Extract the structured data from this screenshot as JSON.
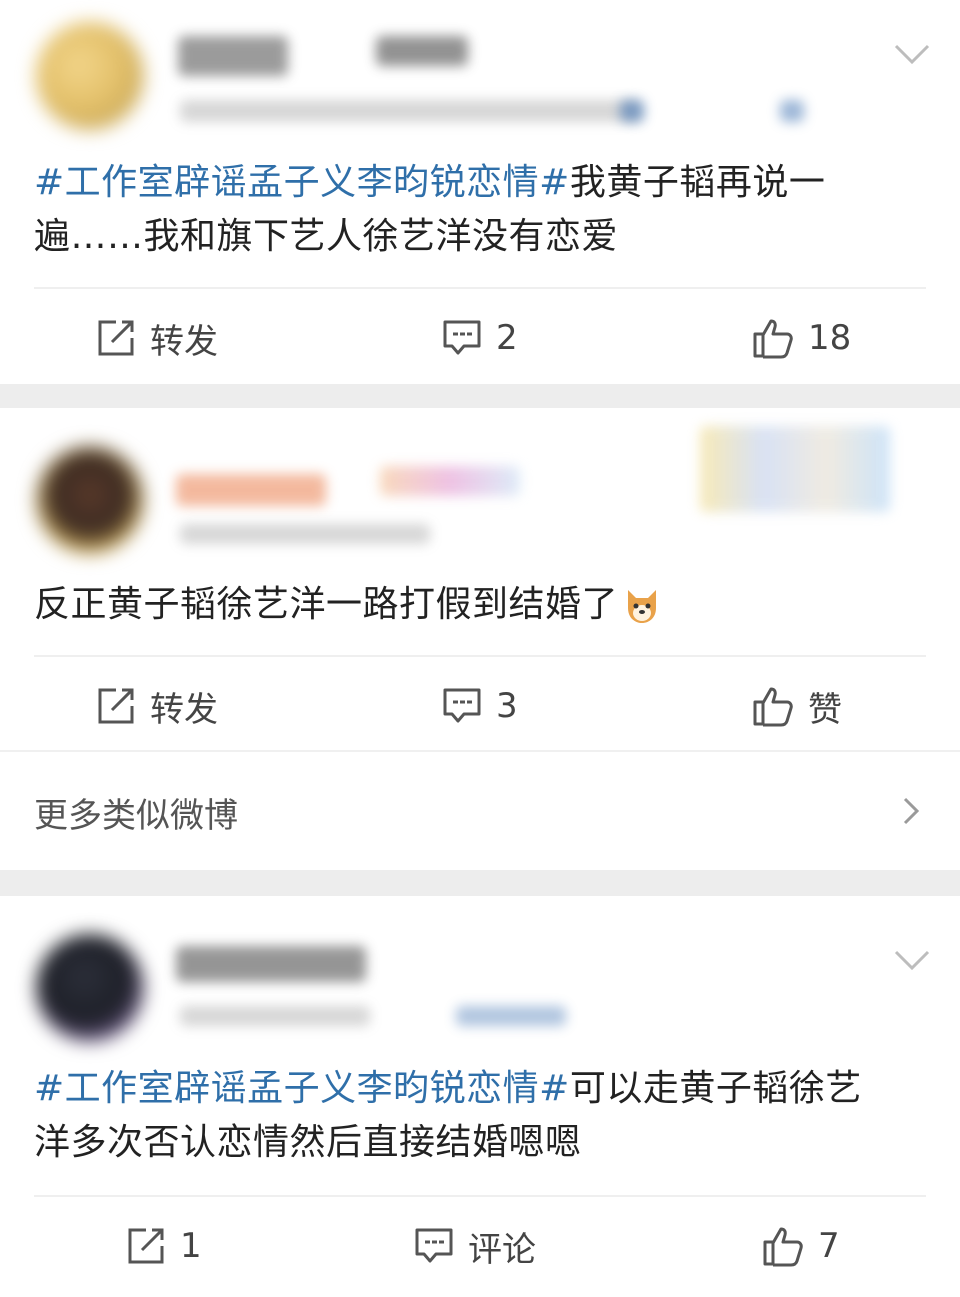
{
  "posts": [
    {
      "topic": "#工作室辟谣孟子义李昀锐恋情#",
      "text": "我黄子韬再说一遍……我和旗下艺人徐艺洋没有恋爱",
      "actions": {
        "repost": "转发",
        "comment": "2",
        "like": "18"
      }
    },
    {
      "text": "反正黄子韬徐艺洋一路打假到结婚了",
      "emoji": "dog-face-emoji",
      "actions": {
        "repost": "转发",
        "comment": "3",
        "like": "赞"
      }
    },
    {
      "topic": "#工作室辟谣孟子义李昀锐恋情#",
      "text": "可以走黄子韬徐艺洋多次否认恋情然后直接结婚嗯嗯",
      "actions": {
        "repost": "1",
        "comment": "评论",
        "like": "7"
      }
    }
  ],
  "more_similar": "更多类似微博",
  "colors": {
    "topic": "#2f6fa9",
    "text": "#222222",
    "background": "#ededed"
  },
  "icons": [
    "repost-icon",
    "comment-icon",
    "like-icon",
    "chevron-down-icon",
    "chevron-right-icon"
  ]
}
